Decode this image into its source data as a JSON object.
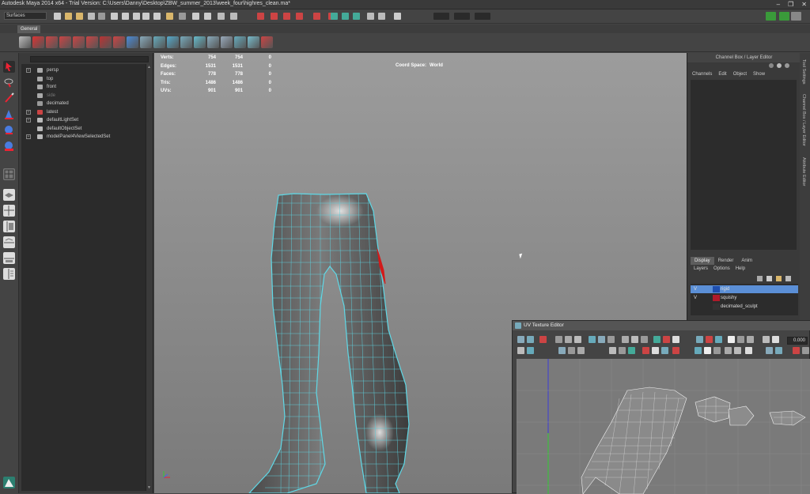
{
  "window": {
    "title": "Autodesk Maya 2014 x64 - Trial Version: C:\\Users\\Danny\\Desktop\\ZBW_summer_2013\\week_four\\highres_clean.ma*",
    "controls": [
      "–",
      "❐",
      "✕"
    ]
  },
  "statusline": {
    "mode": "Surfaces"
  },
  "shelf": {
    "active_tab": "General"
  },
  "outliner": {
    "items": [
      {
        "label": "persp",
        "expandable": true,
        "icon": "camera-icon"
      },
      {
        "label": "top",
        "expandable": false,
        "icon": "camera-icon"
      },
      {
        "label": "front",
        "expandable": false,
        "icon": "camera-icon"
      },
      {
        "label": "side",
        "expandable": false,
        "icon": "camera-icon"
      },
      {
        "label": "decimated",
        "expandable": false,
        "icon": "mesh-icon"
      },
      {
        "label": "latest",
        "expandable": true,
        "icon": "group-icon"
      },
      {
        "label": "defaultLightSet",
        "expandable": true,
        "icon": "set-icon"
      },
      {
        "label": "defaultObjectSet",
        "expandable": false,
        "icon": "set-icon"
      },
      {
        "label": "modelPanel4ViewSelectedSet",
        "expandable": true,
        "icon": "set-icon"
      }
    ]
  },
  "hud": {
    "rows": [
      {
        "label": "Verts:",
        "v1": "754",
        "v2": "754",
        "v3": "0"
      },
      {
        "label": "Edges:",
        "v1": "1531",
        "v2": "1531",
        "v3": "0"
      },
      {
        "label": "Faces:",
        "v1": "778",
        "v2": "778",
        "v3": "0"
      },
      {
        "label": "Tris:",
        "v1": "1486",
        "v2": "1486",
        "v3": "0"
      },
      {
        "label": "UVs:",
        "v1": "901",
        "v2": "901",
        "v3": "0"
      }
    ],
    "coord_label": "Coord Space:",
    "coord_value": "World"
  },
  "channel_box": {
    "header": "Channel Box / Layer Editor",
    "menu": [
      "Channels",
      "Edit",
      "Object",
      "Show"
    ]
  },
  "layer_editor": {
    "tabs": [
      "Display",
      "Render",
      "Anim"
    ],
    "active_tab": "Display",
    "menu": [
      "Layers",
      "Options",
      "Help"
    ],
    "layers": [
      {
        "visible": "V",
        "name": "rigid",
        "color": "#1f4fb0",
        "selected": true
      },
      {
        "visible": "V",
        "name": "squishy",
        "color": "#b01a2a",
        "selected": false
      },
      {
        "visible": "",
        "name": "decimated_sculpt",
        "color": "#333333",
        "selected": false
      }
    ]
  },
  "side_tabs": [
    "Tool Settings",
    "Channel Box / Layer Editor",
    "Attribute Editor"
  ],
  "uv_editor": {
    "title": "UV Texture Editor",
    "field_value": "0.000"
  },
  "colors": {
    "wire": "#5fd8e6",
    "selected_face": "#d21a1a",
    "layer_selected": "#5b8fd6"
  }
}
